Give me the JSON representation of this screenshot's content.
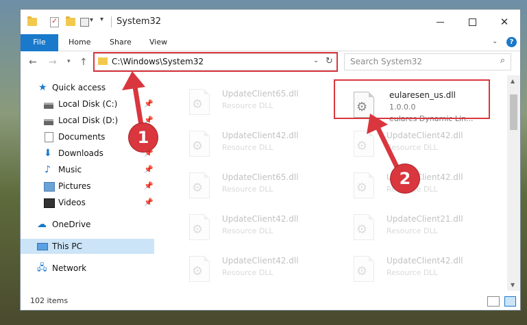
{
  "window": {
    "title": "System32",
    "controls": {
      "minimize": "—",
      "maximize": "☐",
      "close": "✕"
    }
  },
  "ribbon": {
    "tabs": [
      {
        "label": "File"
      },
      {
        "label": "Home"
      },
      {
        "label": "Share"
      },
      {
        "label": "View"
      }
    ],
    "help_label": "?"
  },
  "nav": {
    "address": "C:\\Windows\\System32",
    "search_placeholder": "Search System32"
  },
  "sidebar": {
    "items": [
      {
        "label": "Quick access",
        "icon": "star-icon"
      },
      {
        "label": "Local Disk (C:)",
        "icon": "disk-icon",
        "pinned": true
      },
      {
        "label": "Local Disk (D:)",
        "icon": "disk-icon",
        "pinned": true
      },
      {
        "label": "Documents",
        "icon": "documents-icon",
        "pinned": true
      },
      {
        "label": "Downloads",
        "icon": "downloads-icon",
        "pinned": true
      },
      {
        "label": "Music",
        "icon": "music-icon",
        "pinned": true
      },
      {
        "label": "Pictures",
        "icon": "pictures-icon",
        "pinned": true
      },
      {
        "label": "Videos",
        "icon": "videos-icon",
        "pinned": true
      },
      {
        "label": "OneDrive",
        "icon": "onedrive-icon"
      },
      {
        "label": "This PC",
        "icon": "pc-icon",
        "selected": true
      },
      {
        "label": "Network",
        "icon": "network-icon"
      }
    ]
  },
  "files": {
    "highlighted": {
      "name": "eularesen_us.dll",
      "version": "1.0.0.0",
      "description": "eulares Dynamic Lin..."
    },
    "faded": [
      {
        "name": "UpdateClient65.dll",
        "type": "Resource DLL"
      },
      {
        "name": "UpdateClient42.dll",
        "type": "Resource DLL"
      },
      {
        "name": "UpdateClient42.dll",
        "type": "Resource DLL"
      },
      {
        "name": "UpdateClient65.dll",
        "type": "Resource DLL"
      },
      {
        "name": "UpdateClient42.dll",
        "type": "Resource DLL"
      },
      {
        "name": "UpdateClient42.dll",
        "type": "Resource DLL"
      },
      {
        "name": "UpdateClient42.dll",
        "type": "Resource DLL"
      },
      {
        "name": "UpdateClient21.dll",
        "type": "Resource DLL"
      },
      {
        "name": "UpdateClient42.dll",
        "type": "Resource DLL"
      },
      {
        "name": "UpdateClient42.dll",
        "type": "Resource DLL"
      }
    ]
  },
  "status": {
    "item_count": "102 items"
  },
  "annotations": {
    "badge1": "1",
    "badge2": "2",
    "color": "#d9363e"
  },
  "colors": {
    "accent": "#1979ca",
    "selection": "#cce4f7"
  }
}
